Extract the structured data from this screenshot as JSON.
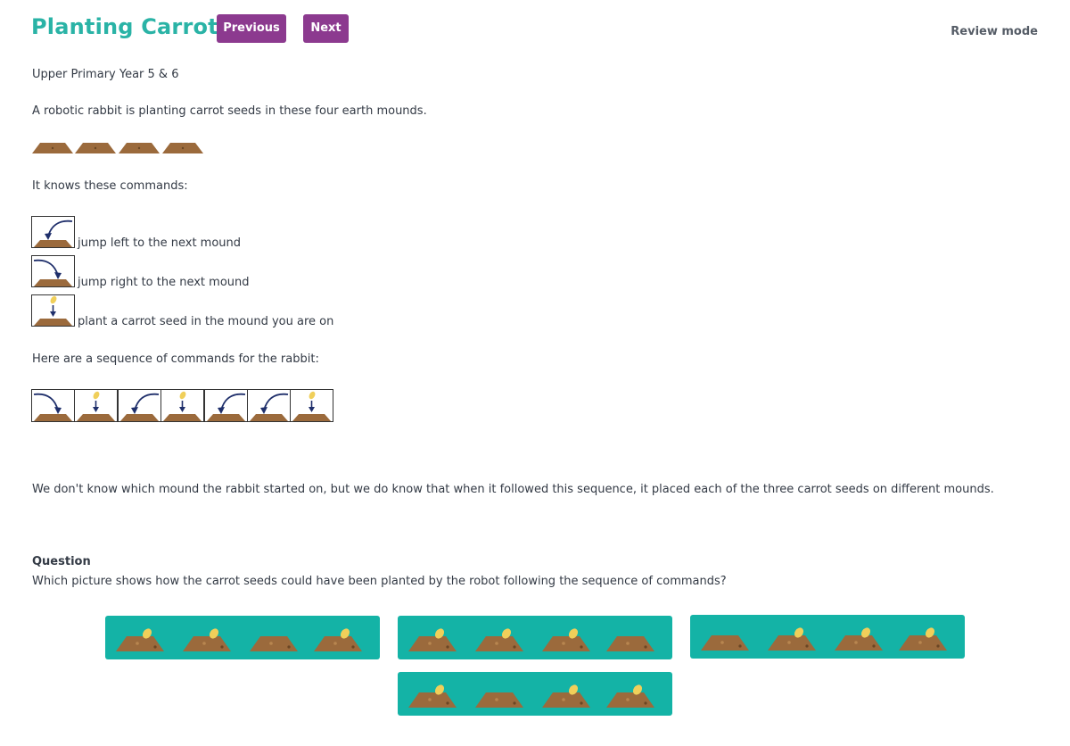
{
  "header": {
    "title": "Planting Carrots",
    "previous_label": "Previous",
    "next_label": "Next",
    "review_mode_label": "Review mode"
  },
  "task": {
    "level": "Upper Primary Year 5 & 6",
    "intro": "A robotic rabbit is planting carrot seeds in these four earth mounds.",
    "knows_commands": "It knows these commands:",
    "commands": [
      {
        "icon": "jump-left-icon",
        "label": "jump left to the next mound"
      },
      {
        "icon": "jump-right-icon",
        "label": "jump right to the next mound"
      },
      {
        "icon": "plant-seed-icon",
        "label": "plant a carrot seed in the mound you are on"
      }
    ],
    "sequence_intro": "Here are a sequence of commands for the rabbit:",
    "sequence": [
      "right",
      "plant",
      "left",
      "plant",
      "left",
      "left",
      "plant"
    ],
    "explanation": "We don't know which mound the rabbit started on, but we do know that when it followed this sequence, it placed each of the three carrot seeds on different mounds.",
    "question_heading": "Question",
    "question": "Which picture shows how the carrot seeds could have been planted by the robot following the sequence of commands?"
  },
  "options": [
    {
      "id": "a",
      "seeds": [
        true,
        true,
        false,
        true
      ]
    },
    {
      "id": "b",
      "seeds": [
        true,
        true,
        true,
        false
      ]
    },
    {
      "id": "c",
      "seeds": [
        false,
        true,
        true,
        true
      ]
    },
    {
      "id": "d",
      "seeds": [
        true,
        false,
        true,
        true
      ]
    }
  ],
  "colors": {
    "title": "#2ab3a6",
    "button": "#8c3a8f",
    "option_bg": "#14b3a6",
    "mound": "#9b6a3c",
    "seed": "#f0cf5a",
    "arrow": "#1f2f6b"
  }
}
